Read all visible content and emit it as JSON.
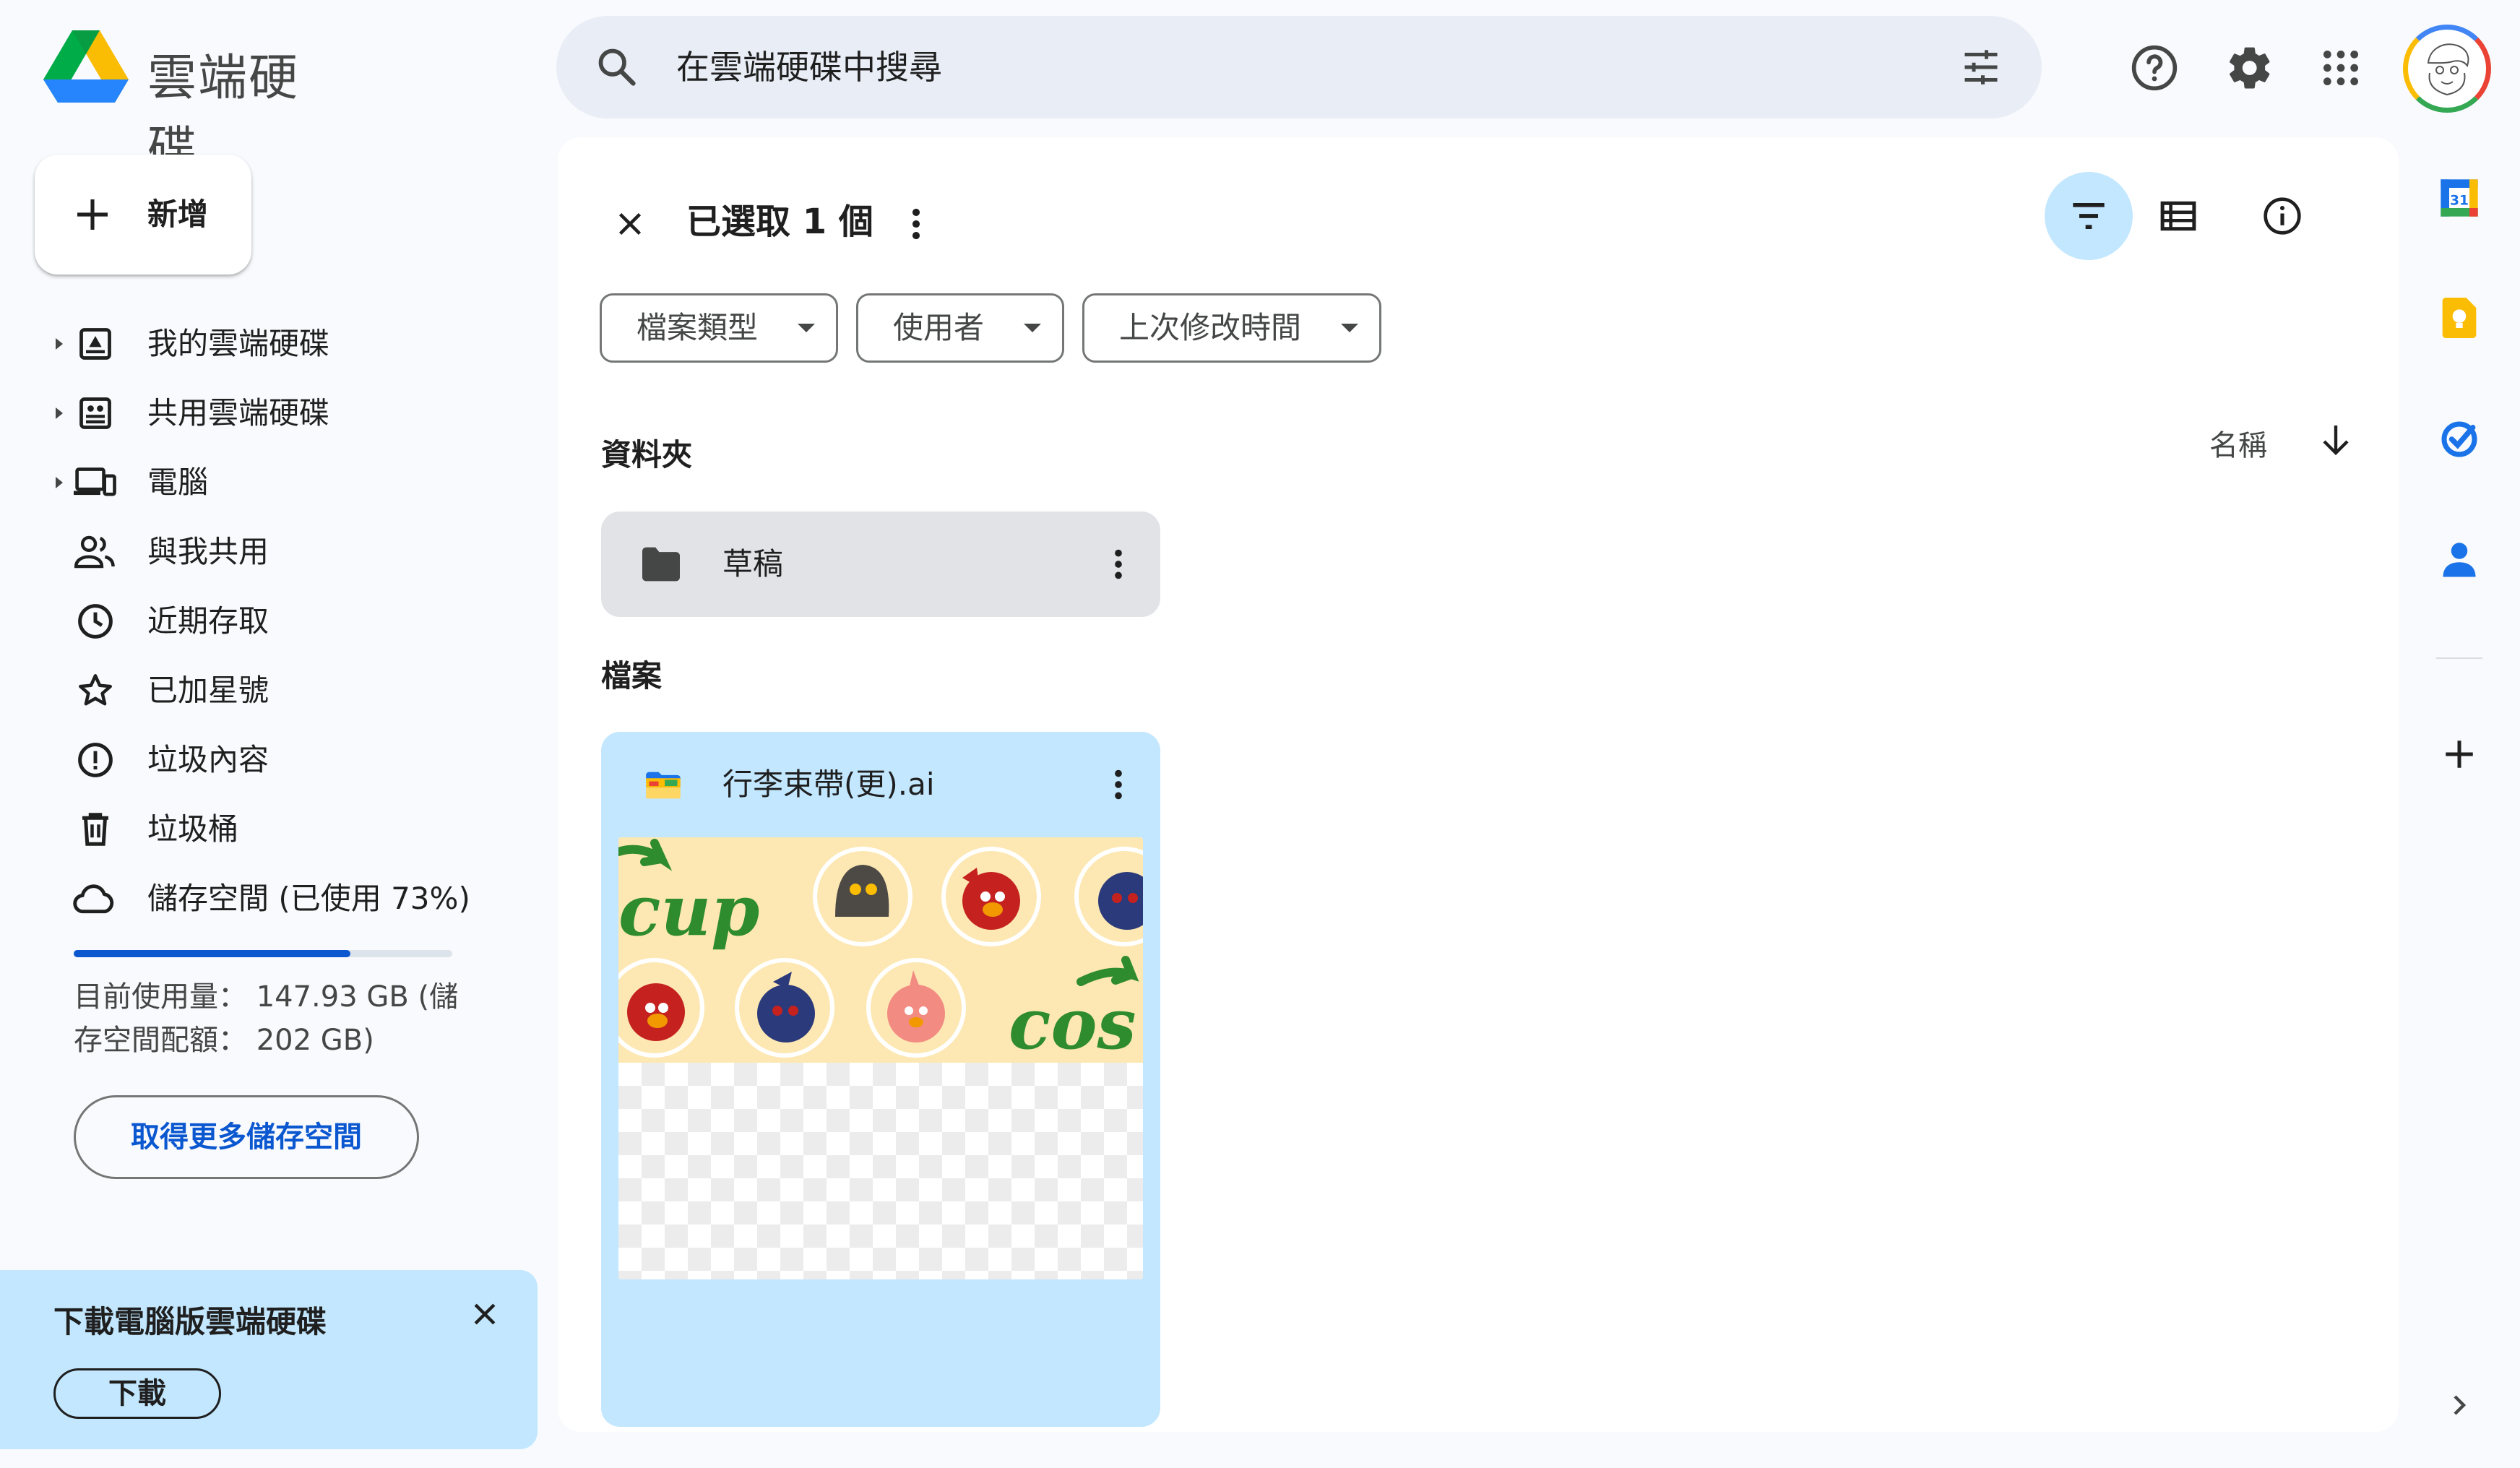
{
  "header": {
    "app_name": "雲端硬碟",
    "search_placeholder": "在雲端硬碟中搜尋",
    "icons": [
      "drive-logo-icon",
      "search-icon",
      "search-options-icon",
      "help-icon",
      "settings-icon",
      "apps-grid-icon",
      "account-avatar"
    ]
  },
  "sidebar": {
    "new_label": "新增",
    "items": [
      {
        "label": "我的雲端硬碟",
        "icon": "my-drive-icon",
        "expandable": true
      },
      {
        "label": "共用雲端硬碟",
        "icon": "shared-drives-icon",
        "expandable": true
      },
      {
        "label": "電腦",
        "icon": "computers-icon",
        "expandable": true
      },
      {
        "label": "與我共用",
        "icon": "people-icon",
        "expandable": false
      },
      {
        "label": "近期存取",
        "icon": "clock-icon",
        "expandable": false
      },
      {
        "label": "已加星號",
        "icon": "star-icon",
        "expandable": false
      },
      {
        "label": "垃圾內容",
        "icon": "spam-icon",
        "expandable": false
      },
      {
        "label": "垃圾桶",
        "icon": "trash-icon",
        "expandable": false
      },
      {
        "label": "儲存空間 (已使用 73%)",
        "icon": "cloud-icon",
        "expandable": false
      }
    ],
    "storage": {
      "used_fraction": 0.73,
      "usage_text": "目前使用量： 147.93 GB (儲存空間配額： 202 GB)",
      "get_more_label": "取得更多儲存空間"
    },
    "promo": {
      "title": "下載電腦版雲端硬碟",
      "download_label": "下載"
    }
  },
  "main": {
    "selection_label": "已選取 1 個",
    "filters": [
      "檔案類型",
      "使用者",
      "上次修改時間"
    ],
    "folders_heading": "資料夾",
    "sort_label": "名稱",
    "files_heading": "檔案",
    "folders": [
      {
        "name": "草稿"
      }
    ],
    "files": [
      {
        "name": "行李束帶(更).ai",
        "thumb_texts": [
          "cup",
          "cos"
        ]
      }
    ]
  },
  "right_rail": {
    "calendar_day": "31",
    "apps": [
      "calendar-icon",
      "keep-icon",
      "tasks-icon",
      "contacts-icon",
      "add-app-icon"
    ]
  },
  "colors": {
    "accent": "#0b57d0",
    "selected_card": "#c2e7ff",
    "folder_card": "#e1e3e7",
    "search_bg": "#e9eef6",
    "page_bg": "#f8fafd"
  }
}
